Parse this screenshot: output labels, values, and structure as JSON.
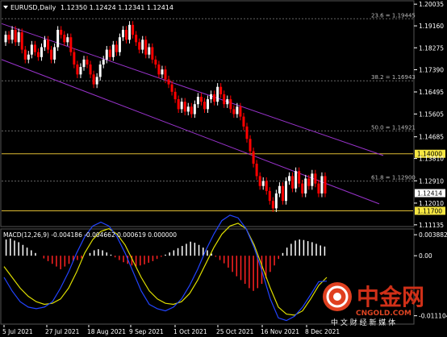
{
  "header": {
    "symbol": "EURUSD,Daily",
    "ohlc": "1.12350 1.12424 1.12341 1.12414"
  },
  "macd_header": "MACD(12,26,9) -0.004186 -0.004662 0.000619 0.000000",
  "price_axis": {
    "ticks": [
      "1.20035",
      "1.19160",
      "1.18275",
      "1.17390",
      "1.16495",
      "1.15605",
      "1.14685",
      "1.13810",
      "1.12910",
      "1.12010",
      "1.11135"
    ],
    "range": [
      1.1113,
      1.2004
    ]
  },
  "macd_axis": {
    "ticks": [
      "0.003882",
      "0.00",
      "-0.011104"
    ]
  },
  "fib_levels": [
    {
      "label": "23.6 = 1.19445",
      "value": 1.19445
    },
    {
      "label": "38.2 = 1.16943",
      "value": 1.16943
    },
    {
      "label": "50.0 = 1.14921",
      "value": 1.14921
    },
    {
      "label": "61.8 = 1.12900",
      "value": 1.129
    }
  ],
  "hlines": [
    {
      "label": "1.14000",
      "value": 1.14
    },
    {
      "label": "1.11700",
      "value": 1.117
    }
  ],
  "current_price": "1.12414",
  "date_labels": [
    "5 Jul 2021",
    "27 Jul 2021",
    "18 Aug 2021",
    "9 Sep 2021",
    "1 Oct 2021",
    "25 Oct 2021",
    "16 Nov 2021",
    "8 Dec 2021"
  ],
  "colors": {
    "background": "#000000",
    "bull": "#FFFFFF",
    "bear": "#FF0000",
    "channel": "#9933CC",
    "hline": "#DDBB33",
    "fib": "#666666",
    "macd_signal": "#DDDD00",
    "macd_line": "#2244FF"
  },
  "chart_data": {
    "type": "candlestick",
    "candles_close": [
      1.188,
      1.186,
      1.19,
      1.185,
      1.189,
      1.182,
      1.178,
      1.18,
      1.184,
      1.181,
      1.179,
      1.183,
      1.186,
      1.182,
      1.178,
      1.183,
      1.19,
      1.188,
      1.185,
      1.187,
      1.181,
      1.176,
      1.172,
      1.175,
      1.178,
      1.176,
      1.172,
      1.168,
      1.171,
      1.176,
      1.178,
      1.182,
      1.179,
      1.184,
      1.181,
      1.187,
      1.19,
      1.186,
      1.192,
      1.188,
      1.185,
      1.182,
      1.186,
      1.18,
      1.183,
      1.178,
      1.176,
      1.172,
      1.174,
      1.17,
      1.168,
      1.165,
      1.162,
      1.158,
      1.161,
      1.157,
      1.159,
      1.156,
      1.16,
      1.163,
      1.161,
      1.158,
      1.162,
      1.164,
      1.161,
      1.167,
      1.164,
      1.16,
      1.162,
      1.158,
      1.156,
      1.159,
      1.155,
      1.151,
      1.146,
      1.141,
      1.136,
      1.131,
      1.127,
      1.129,
      1.125,
      1.121,
      1.118,
      1.124,
      1.127,
      1.121,
      1.129,
      1.131,
      1.126,
      1.133,
      1.128,
      1.124,
      1.13,
      1.127,
      1.132,
      1.128,
      1.124,
      1.131,
      1.124
    ],
    "macd_hist": [
      0.003,
      0.0032,
      0.0028,
      0.0025,
      0.002,
      0.0015,
      0.001,
      0.0005,
      0.0,
      -0.0005,
      -0.001,
      -0.0015,
      -0.002,
      -0.0025,
      -0.002,
      -0.0015,
      -0.001,
      -0.0008,
      -0.0005,
      0.0,
      0.0005,
      0.001,
      0.0012,
      0.001,
      0.0006,
      0.0002,
      -0.0003,
      -0.0008,
      -0.0012,
      -0.0015,
      -0.0018,
      -0.002,
      -0.0018,
      -0.0016,
      -0.0013,
      -0.001,
      -0.0006,
      -0.0002,
      0.0002,
      0.0006,
      0.001,
      0.0014,
      0.0018,
      0.0022,
      0.0026,
      0.0024,
      0.002,
      0.0015,
      0.001,
      0.0004,
      -0.0002,
      -0.0008,
      -0.0014,
      -0.0022,
      -0.003,
      -0.0038,
      -0.0045,
      -0.0052,
      -0.006,
      -0.0065,
      -0.006,
      -0.0052,
      -0.0042,
      -0.003,
      -0.0018,
      -0.0006,
      0.0005,
      0.0015,
      0.0022,
      0.0028,
      0.003,
      0.0029,
      0.0027,
      0.0025,
      0.0022,
      0.0019,
      0.0017
    ],
    "macd_signal": [
      -0.002,
      -0.004,
      -0.006,
      -0.0075,
      -0.0085,
      -0.009,
      -0.0088,
      -0.008,
      -0.006,
      -0.003,
      0.0005,
      0.003,
      0.0045,
      0.005,
      0.004,
      0.002,
      -0.001,
      -0.004,
      -0.0065,
      -0.008,
      -0.0088,
      -0.009,
      -0.0085,
      -0.007,
      -0.0045,
      -0.0015,
      0.0015,
      0.004,
      0.0055,
      0.006,
      0.005,
      0.002,
      -0.002,
      -0.006,
      -0.0095,
      -0.0108,
      -0.011,
      -0.0102,
      -0.008,
      -0.0055,
      -0.004
    ],
    "macd_line": [
      -0.004,
      -0.0065,
      -0.0085,
      -0.0095,
      -0.0098,
      -0.0095,
      -0.0085,
      -0.006,
      -0.003,
      0.0005,
      0.0035,
      0.0055,
      0.0062,
      0.0055,
      0.0035,
      0.0005,
      -0.003,
      -0.0065,
      -0.009,
      -0.0098,
      -0.0102,
      -0.0095,
      -0.008,
      -0.0055,
      -0.0025,
      0.001,
      0.004,
      0.0065,
      0.0075,
      0.007,
      0.005,
      0.0015,
      -0.003,
      -0.008,
      -0.0115,
      -0.012,
      -0.0112,
      -0.0095,
      -0.0072,
      -0.0048,
      -0.0047
    ]
  },
  "watermark": {
    "cn": "中金网",
    "url": "CNGOLD.COM",
    "tagline": "中 文 财 经 新 媒 体"
  }
}
